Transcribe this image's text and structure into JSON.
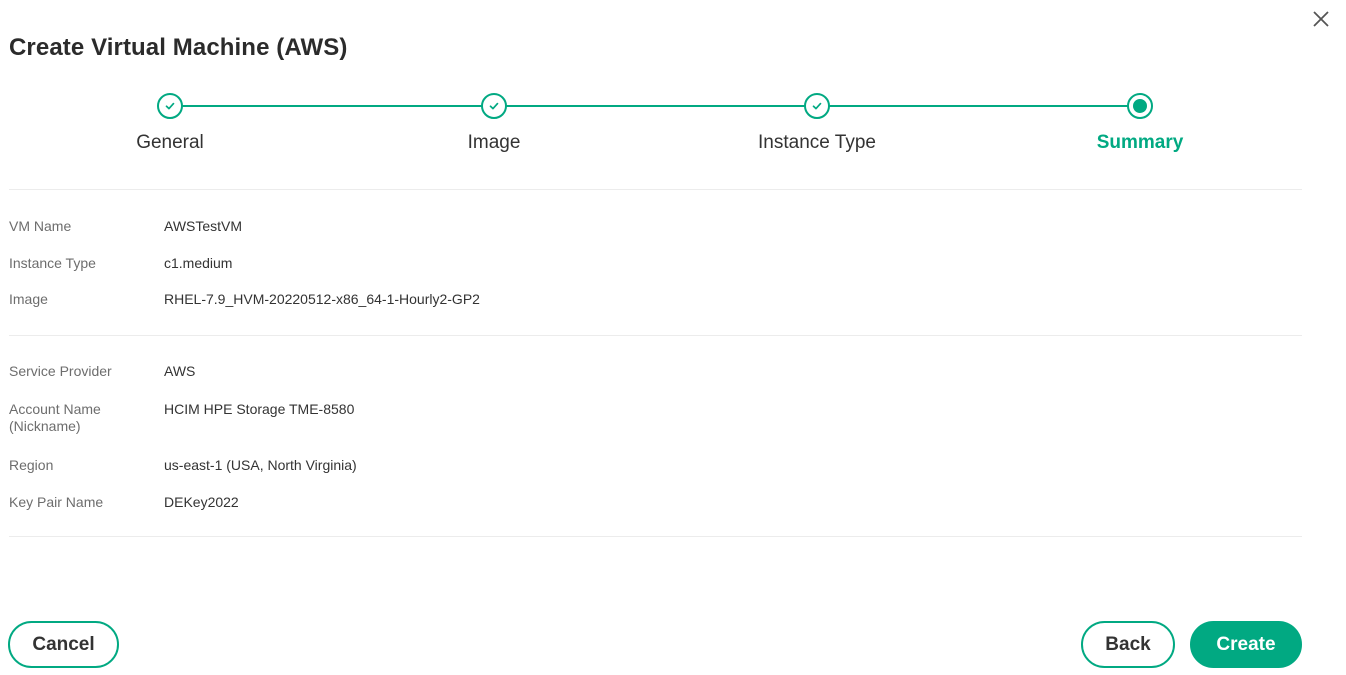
{
  "dialog": {
    "title": "Create Virtual Machine (AWS)",
    "close_icon": "close-icon"
  },
  "stepper": {
    "accent_color": "#01a982",
    "steps": [
      {
        "label": "General",
        "status": "completed",
        "icon": "check-icon"
      },
      {
        "label": "Image",
        "status": "completed",
        "icon": "check-icon"
      },
      {
        "label": "Instance Type",
        "status": "completed",
        "icon": "check-icon"
      },
      {
        "label": "Summary",
        "status": "active",
        "icon": "dot-icon"
      }
    ]
  },
  "summary": {
    "section1": [
      {
        "label": "VM Name",
        "value": "AWSTestVM"
      },
      {
        "label": "Instance Type",
        "value": "c1.medium"
      },
      {
        "label": "Image",
        "value": "RHEL-7.9_HVM-20220512-x86_64-1-Hourly2-GP2"
      }
    ],
    "section2": [
      {
        "label": "Service Provider",
        "value": "AWS"
      },
      {
        "label": "Account Name",
        "label_line2": "(Nickname)",
        "value": "HCIM HPE Storage TME-8580"
      },
      {
        "label": "Region",
        "value": "us-east-1 (USA, North Virginia)"
      },
      {
        "label": "Key Pair Name",
        "value": "DEKey2022"
      }
    ]
  },
  "footer": {
    "cancel_label": "Cancel",
    "back_label": "Back",
    "create_label": "Create"
  }
}
